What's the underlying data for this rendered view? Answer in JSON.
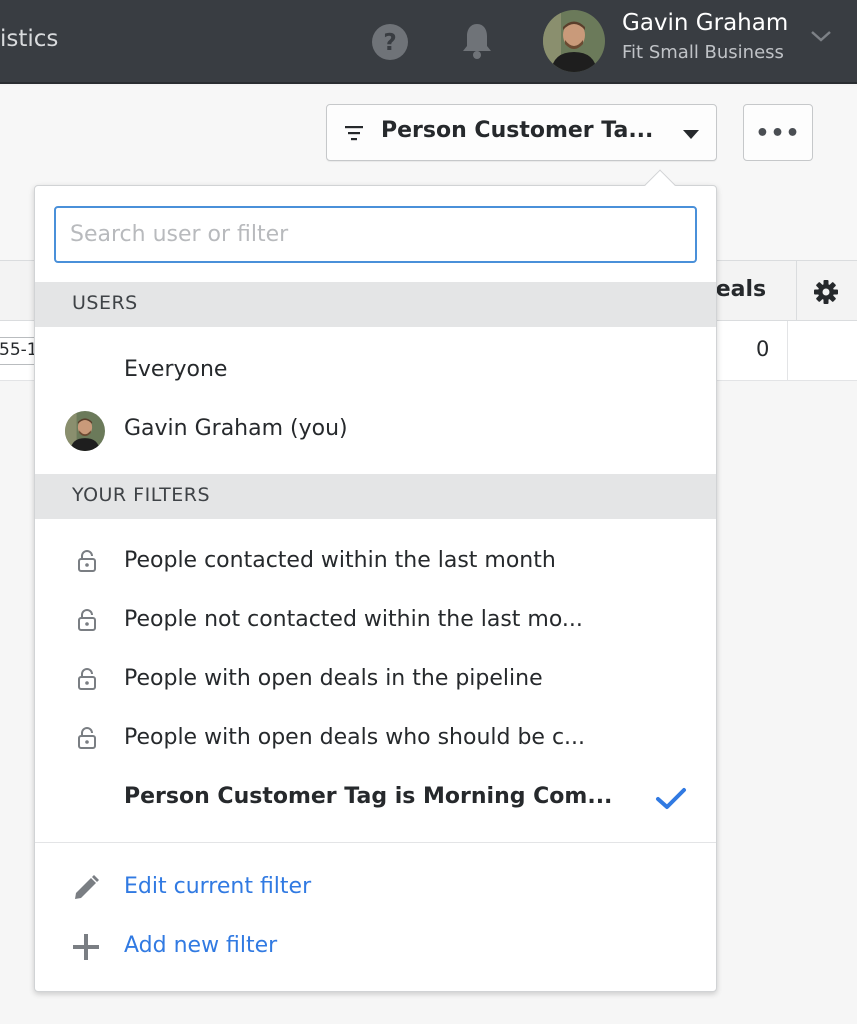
{
  "topbar": {
    "nav_fragment": "istics",
    "user_name": "Gavin Graham",
    "user_company": "Fit Small Business",
    "icons": {
      "help": "help-circle-icon",
      "notifications": "bell-icon",
      "menu": "chevron-down-icon"
    }
  },
  "toolbar": {
    "filter_label": "Person Customer Ta...",
    "more_label": "•••"
  },
  "table": {
    "header_deals": "deals",
    "row_left_value": "55-1",
    "row_deals_value": "0"
  },
  "dropdown": {
    "search_placeholder": "Search user or filter",
    "users_header": "USERS",
    "users": [
      {
        "label": "Everyone"
      },
      {
        "label": "Gavin Graham (you)"
      }
    ],
    "filters_header": "YOUR FILTERS",
    "filters": [
      {
        "label": "People contacted within the last month",
        "locked": true
      },
      {
        "label": "People not contacted within the last mo...",
        "locked": true
      },
      {
        "label": "People with open deals in the pipeline",
        "locked": true
      },
      {
        "label": "People with open deals who should be c...",
        "locked": true
      },
      {
        "label": "Person Customer Tag is Morning Com...",
        "locked": false,
        "selected": true
      }
    ],
    "actions": [
      {
        "label": "Edit current filter",
        "icon": "pencil-icon"
      },
      {
        "label": "Add new filter",
        "icon": "plus-icon"
      }
    ]
  },
  "colors": {
    "topbar_bg": "#393d42",
    "accent_blue": "#317ae2",
    "focus_border": "#4a90d9",
    "section_header_bg": "#e4e5e6"
  }
}
